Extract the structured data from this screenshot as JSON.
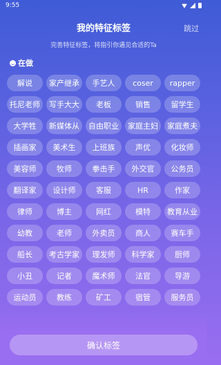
{
  "status_bar": {
    "time": "9:55"
  },
  "header": {
    "title": "我的特征标签",
    "skip_label": "跳过"
  },
  "subtitle": "完善特征标签，将指引你遇见合适的Ta",
  "section": {
    "label": "在做"
  },
  "tag_rows": [
    [
      "解说",
      "家产继承",
      "手艺人",
      "coser",
      "rapper"
    ],
    [
      "托尼老师",
      "写手大大",
      "老板",
      "销售",
      "留学生"
    ],
    [
      "大学牲",
      "新媒体从",
      "自由职业",
      "家庭主妇",
      "家庭煮夫"
    ],
    [
      "插画家",
      "美术生",
      "上班族",
      "声优",
      "化妆师"
    ],
    [
      "美容师",
      "牧师",
      "拳击手",
      "外交官",
      "公务员"
    ],
    [
      "翻译家",
      "设计师",
      "客服",
      "HR",
      "作家"
    ],
    [
      "律师",
      "博主",
      "网红",
      "模特",
      "教育从业"
    ],
    [
      "幼教",
      "老师",
      "外卖员",
      "商人",
      "赛车手"
    ],
    [
      "船长",
      "考古学家",
      "理发师",
      "科学家",
      "厨师"
    ],
    [
      "小丑",
      "记者",
      "魔术师",
      "法官",
      "导游"
    ],
    [
      "运动员",
      "教练",
      "矿工",
      "宿管",
      "服务员"
    ]
  ],
  "confirm_label": "确认标签",
  "colors": {
    "background_top": "#3f5bd6",
    "background_bottom": "#9a6ef0",
    "tag_fill": "rgba(255,255,255,0.22)"
  }
}
